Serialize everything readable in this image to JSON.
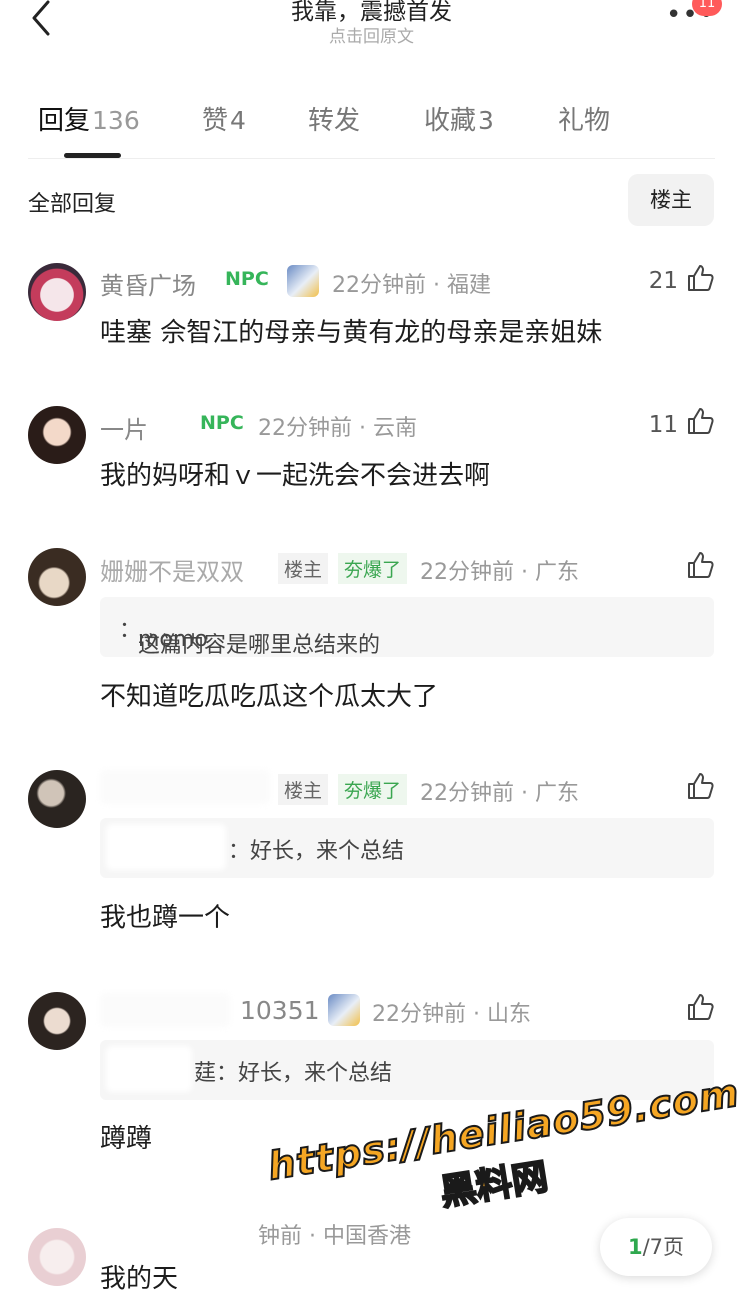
{
  "header": {
    "title": "我靠，震撼首发",
    "subtitle": "点击回原文",
    "badge_count": "11"
  },
  "tabs": [
    {
      "label": "回复",
      "count": "136"
    },
    {
      "label": "赞",
      "count": "4"
    },
    {
      "label": "转发",
      "count": ""
    },
    {
      "label": "收藏",
      "count": "3"
    },
    {
      "label": "礼物",
      "count": ""
    }
  ],
  "filter": {
    "all_label": "全部回复",
    "owner_label": "楼主"
  },
  "comments": [
    {
      "username": "黄昏广场",
      "tag": "NPC",
      "time": "22分钟前",
      "location": "福建",
      "likes": "21",
      "text": "哇塞 佘智江的母亲与黄有龙的母亲是亲姐妹"
    },
    {
      "username": "一片",
      "tag": "NPC",
      "time": "22分钟前",
      "location": "云南",
      "likes": "11",
      "text": "我的妈呀和ｖ一起洗会不会进去啊"
    },
    {
      "username": "姗姗不是双双",
      "owner_tag": "楼主",
      "hot_tag": "夯爆了",
      "time": "22分钟前",
      "location": "广东",
      "likes": "",
      "quote_user": "momo",
      "quote_text": "这篇内容是哪里总结来的",
      "text": "不知道吃瓜吃瓜这个瓜太大了"
    },
    {
      "username": "",
      "owner_tag": "楼主",
      "hot_tag": "夯爆了",
      "time": "22分钟前",
      "location": "广东",
      "likes": "",
      "quote_text": "：好长，来个总结",
      "text": "我也蹲一个"
    },
    {
      "username": "10351",
      "time": "22分钟前",
      "location": "山东",
      "likes": "",
      "quote_text": "莛：好长，来个总结",
      "text": "蹲蹲"
    },
    {
      "time": "钟前",
      "location": "中国香港",
      "text": "我的天"
    }
  ],
  "watermark": {
    "url": "https://heiliao59.com",
    "name": "黑料网"
  },
  "pager": {
    "current": "1",
    "rest": "/7页"
  }
}
